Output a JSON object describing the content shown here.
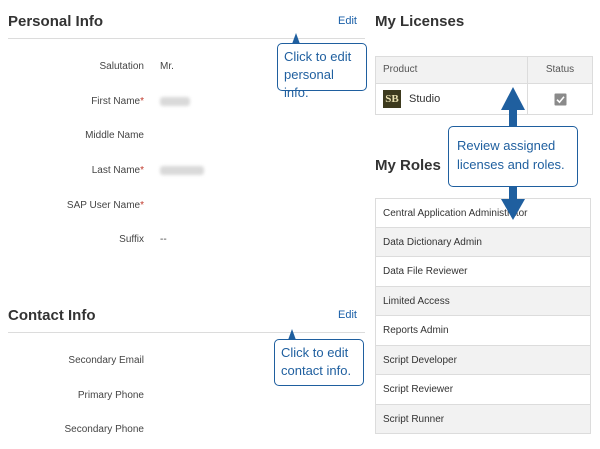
{
  "personal_info": {
    "title": "Personal Info",
    "edit_label": "Edit",
    "fields": {
      "salutation": {
        "label": "Salutation",
        "value": "Mr."
      },
      "first_name": {
        "label": "First Name",
        "required_mark": "*"
      },
      "middle_name": {
        "label": "Middle Name"
      },
      "last_name": {
        "label": "Last Name",
        "required_mark": "*"
      },
      "sap_user_name": {
        "label": "SAP User Name",
        "required_mark": "*"
      },
      "suffix": {
        "label": "Suffix",
        "value": "--"
      }
    }
  },
  "contact_info": {
    "title": "Contact Info",
    "edit_label": "Edit",
    "fields": {
      "secondary_email": {
        "label": "Secondary Email"
      },
      "primary_phone": {
        "label": "Primary Phone"
      },
      "secondary_phone": {
        "label": "Secondary Phone"
      }
    }
  },
  "licenses": {
    "title": "My Licenses",
    "columns": {
      "product": "Product",
      "status": "Status"
    },
    "rows": [
      {
        "product_logo": "SB",
        "product": "Studio",
        "status_icon": "check-icon"
      }
    ]
  },
  "roles": {
    "title": "My Roles",
    "items": [
      "Central Application Administrator",
      "Data Dictionary Admin",
      "Data File Reviewer",
      "Limited Access",
      "Reports Admin",
      "Script Developer",
      "Script Reviewer",
      "Script Runner"
    ]
  },
  "callouts": {
    "personal_edit": {
      "line1": "Click to edit",
      "line2": "personal info."
    },
    "contact_edit": {
      "line1": "Click to edit",
      "line2": "contact info."
    },
    "review": {
      "line1": "Review assigned",
      "line2": "licenses and roles."
    }
  },
  "colors": {
    "accent": "#1f5f9f",
    "link": "#1a5fa8",
    "required": "#c0392b"
  }
}
